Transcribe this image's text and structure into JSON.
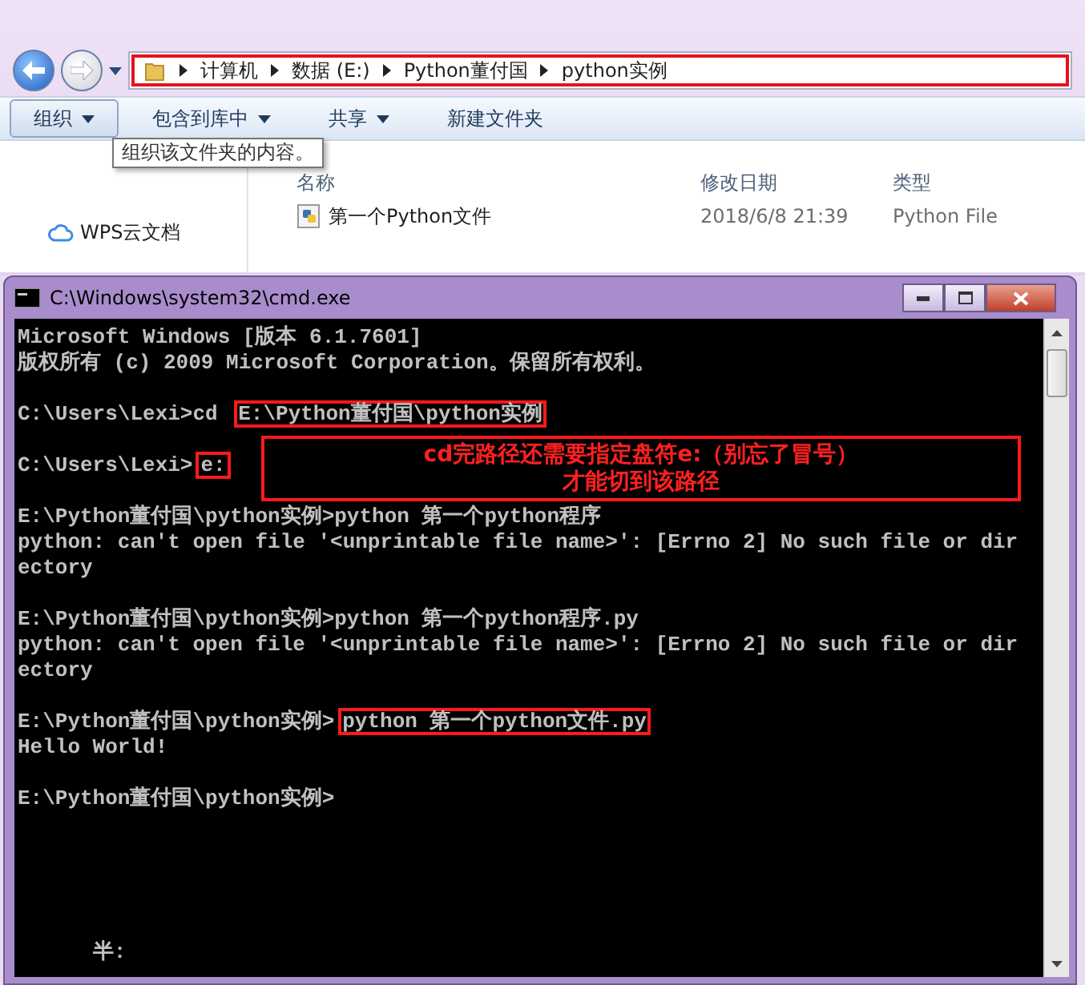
{
  "explorer": {
    "breadcrumbs": [
      "计算机",
      "数据 (E:)",
      "Python董付国",
      "python实例"
    ],
    "breadcrumbs_highlighted": true,
    "toolbar": [
      {
        "label": "组织",
        "dropdown": true,
        "selected": true
      },
      {
        "label": "包含到库中",
        "dropdown": true,
        "selected": false
      },
      {
        "label": "共享",
        "dropdown": true,
        "selected": false
      },
      {
        "label": "新建文件夹",
        "dropdown": false,
        "selected": false
      }
    ],
    "tooltip": "组织该文件夹的内容。",
    "sidebar": [
      {
        "label": "WPS云文档"
      }
    ],
    "columns": [
      "名称",
      "修改日期",
      "类型"
    ],
    "files": [
      {
        "name": "第一个Python文件",
        "modified": "2018/6/8 21:39",
        "type": "Python File"
      }
    ]
  },
  "cmd": {
    "title": "C:\\Windows\\system32\\cmd.exe",
    "lines": [
      {
        "kind": "text",
        "segments": [
          {
            "text": "Microsoft Windows [版本 6.1.7601]",
            "highlighted": false
          }
        ]
      },
      {
        "kind": "text",
        "segments": [
          {
            "text": "版权所有 (c) 2009 Microsoft Corporation。保留所有权利。",
            "highlighted": false
          }
        ]
      },
      {
        "kind": "blank"
      },
      {
        "kind": "text",
        "segments": [
          {
            "text": "C:\\Users\\Lexi>cd ",
            "highlighted": false
          },
          {
            "text": "E:\\Python董付国\\python实例",
            "highlighted": true
          }
        ]
      },
      {
        "kind": "blank"
      },
      {
        "kind": "text",
        "segments": [
          {
            "text": "C:\\Users\\Lexi>",
            "highlighted": false
          },
          {
            "text": "e:",
            "highlighted": true
          }
        ]
      },
      {
        "kind": "blank"
      },
      {
        "kind": "text",
        "segments": [
          {
            "text": "E:\\Python董付国\\python实例>python 第一个python程序",
            "highlighted": false
          }
        ]
      },
      {
        "kind": "text",
        "segments": [
          {
            "text": "python: can't open file '<unprintable file name>': [Errno 2] No such file or dir",
            "highlighted": false
          }
        ]
      },
      {
        "kind": "text",
        "segments": [
          {
            "text": "ectory",
            "highlighted": false
          }
        ]
      },
      {
        "kind": "blank"
      },
      {
        "kind": "text",
        "segments": [
          {
            "text": "E:\\Python董付国\\python实例>python 第一个python程序.py",
            "highlighted": false
          }
        ]
      },
      {
        "kind": "text",
        "segments": [
          {
            "text": "python: can't open file '<unprintable file name>': [Errno 2] No such file or dir",
            "highlighted": false
          }
        ]
      },
      {
        "kind": "text",
        "segments": [
          {
            "text": "ectory",
            "highlighted": false
          }
        ]
      },
      {
        "kind": "blank"
      },
      {
        "kind": "text",
        "segments": [
          {
            "text": "E:\\Python董付国\\python实例>",
            "highlighted": false
          },
          {
            "text": "python 第一个python文件.py",
            "highlighted": true
          }
        ]
      },
      {
        "kind": "text",
        "segments": [
          {
            "text": "Hello World!",
            "highlighted": false
          }
        ]
      },
      {
        "kind": "blank"
      },
      {
        "kind": "text",
        "segments": [
          {
            "text": "E:\\Python董付国\\python实例>",
            "highlighted": false
          }
        ]
      }
    ],
    "annotation": [
      "cd完路径还需要指定盘符e:（别忘了冒号）",
      "才能切到该路径"
    ],
    "ime_status": "半:"
  }
}
